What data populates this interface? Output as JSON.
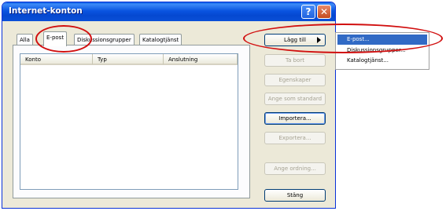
{
  "window": {
    "title": "Internet-konton"
  },
  "tabs": [
    {
      "label": "Alla"
    },
    {
      "label": "E-post"
    },
    {
      "label": "Diskussionsgrupper"
    },
    {
      "label": "Katalogtjänst"
    }
  ],
  "list": {
    "columns": [
      "Konto",
      "Typ",
      "Anslutning"
    ]
  },
  "buttons": {
    "add": "Lägg till",
    "remove": "Ta bort",
    "properties": "Egenskaper",
    "set_default": "Ange som standard",
    "import": "Importera...",
    "export": "Exportera...",
    "set_order": "Ange ordning...",
    "close": "Stäng"
  },
  "add_menu": {
    "items": [
      {
        "label": "E-post..."
      },
      {
        "label": "Diskussionsgrupper..."
      },
      {
        "label": "Katalogtjänst..."
      }
    ]
  },
  "colors": {
    "titlebar": "#0548d0",
    "highlight": "#316ac5",
    "annotation": "#d10f0f"
  }
}
